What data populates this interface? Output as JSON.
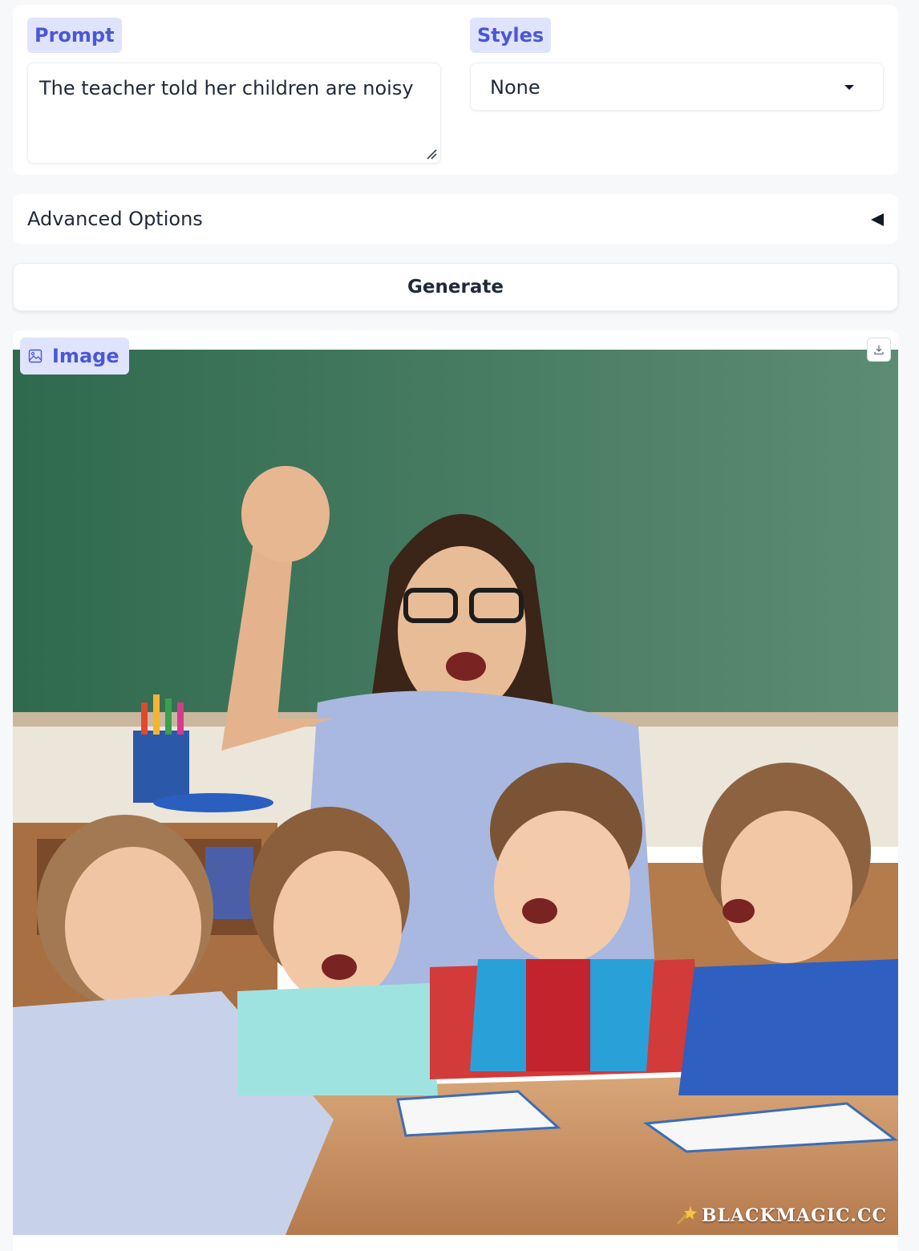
{
  "prompt": {
    "label": "Prompt",
    "value": "The teacher told her children are noisy"
  },
  "styles": {
    "label": "Styles",
    "selected": "None"
  },
  "advanced": {
    "label": "Advanced Options"
  },
  "generate": {
    "label": "Generate"
  },
  "output": {
    "label": "Image",
    "watermark": "BLACKMAGIC.CC",
    "icons": [
      "image-icon",
      "download-icon",
      "resize-grip-icon",
      "chevron-down-icon",
      "collapse-arrow-icon",
      "wand-icon"
    ]
  },
  "colors": {
    "accent": "#4a57d6",
    "chip_background": "#dfe3fb",
    "page_background": "#f7f8fa"
  }
}
